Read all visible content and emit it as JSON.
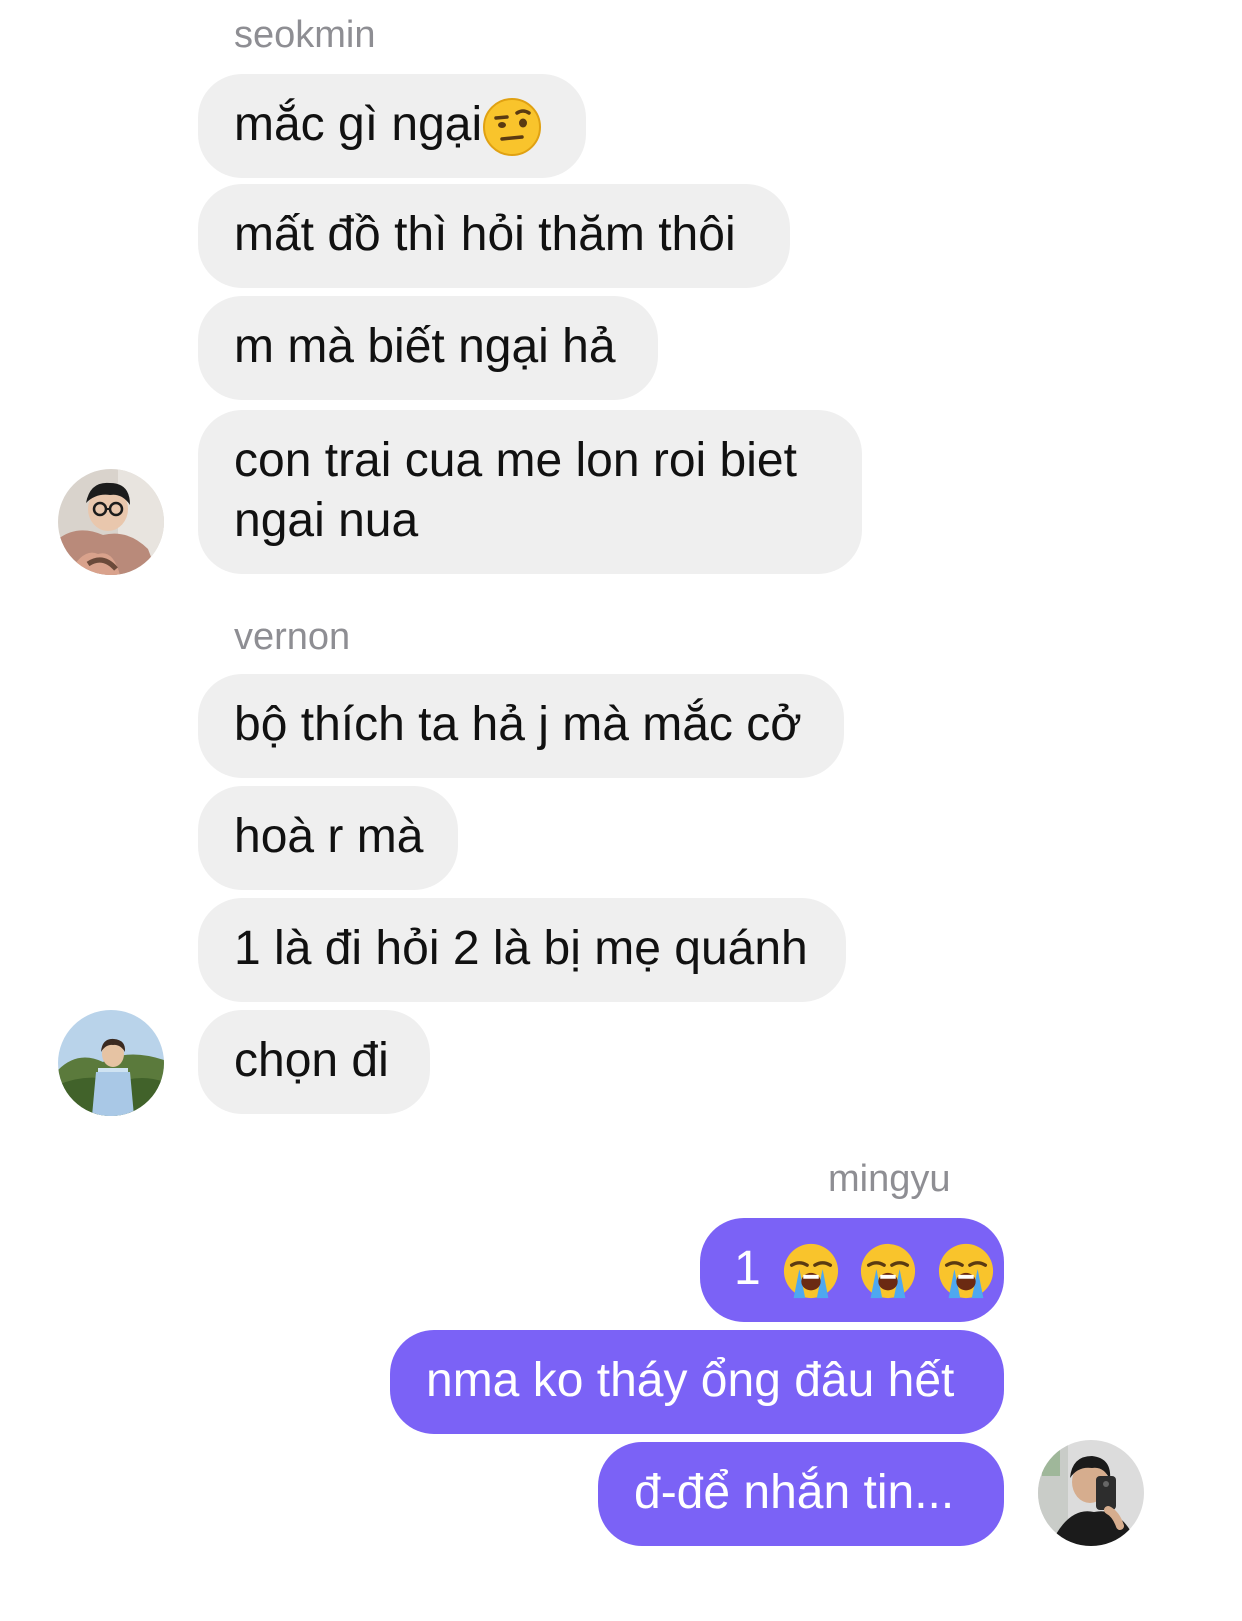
{
  "groups": [
    {
      "sender": "seokmin",
      "messages": [
        {
          "text": "mắc gì ngại",
          "emoji": "raised-eyebrow-face-icon"
        },
        {
          "text": "mất đồ thì hỏi thăm thôi"
        },
        {
          "text": "m mà biết ngại hả"
        },
        {
          "text": "con trai cua me lon roi biet ngai nua"
        }
      ],
      "avatar": "avatar-seokmin"
    },
    {
      "sender": "vernon",
      "messages": [
        {
          "text": "bộ thích ta hả j mà mắc cở"
        },
        {
          "text": "hoà r mà"
        },
        {
          "text": "1 là đi hỏi 2 là bị mẹ quánh"
        },
        {
          "text": "chọn đi"
        }
      ],
      "avatar": "avatar-vernon"
    },
    {
      "sender": "mingyu",
      "messages": [
        {
          "text": "1",
          "emoji": "loudly-crying-face-icon",
          "emoji_count": 3
        },
        {
          "text": "nma ko tháy ổng đâu hết"
        },
        {
          "text": "đ-để nhắn tin..."
        }
      ],
      "avatar": "avatar-mingyu"
    }
  ],
  "colors": {
    "incoming_bubble": "#efefef",
    "outgoing_bubble": "#7b62f6",
    "sender_name": "#8e8e93"
  }
}
